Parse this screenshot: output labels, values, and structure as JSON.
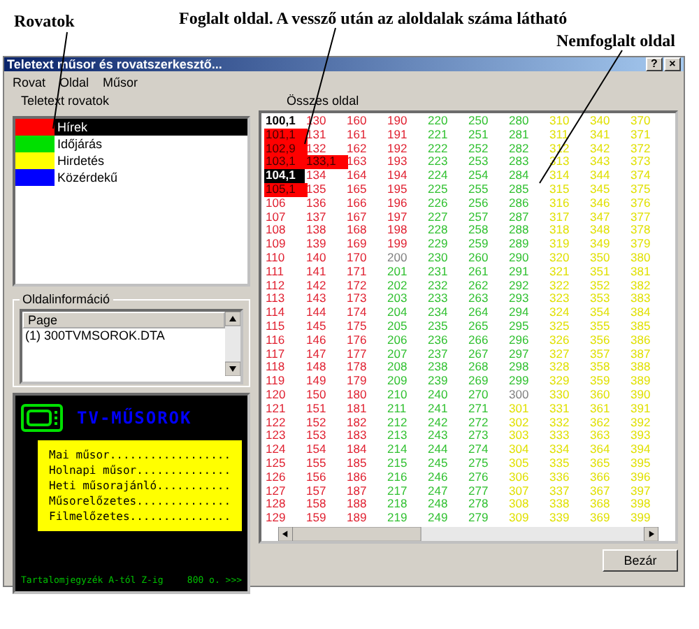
{
  "annotations": [
    {
      "text": "Rovatok"
    },
    {
      "text": "Foglalt oldal. A vessző után az aloldalak száma látható"
    },
    {
      "text": "Nemfoglalt oldal"
    }
  ],
  "window": {
    "title": "Teletext műsor és rovatszerkesztő...",
    "title_buttons": [
      "?",
      "×"
    ]
  },
  "menu": [
    "Rovat",
    "Oldal",
    "Műsor"
  ],
  "rubrics": {
    "label": "Teletext rovatok",
    "items": [
      {
        "name": "Hírek",
        "color": "#ff0000",
        "selected": true
      },
      {
        "name": "Időjárás",
        "color": "#00e000",
        "selected": false
      },
      {
        "name": "Hirdetés",
        "color": "#ffff00",
        "selected": false
      },
      {
        "name": "Közérdekű",
        "color": "#0000ff",
        "selected": false
      }
    ]
  },
  "page_info": {
    "label": "Oldalinformáció",
    "header": "Page",
    "items": [
      "(1) 300TVMSOROK.DTA"
    ]
  },
  "teletext": {
    "title": "TV-MŰSOROK",
    "lines": [
      "Mai műsor..................",
      "Holnapi műsor..............",
      "Heti műsorajánló...........",
      "Műsorelőzetes..............",
      "Filmelőzetes..............."
    ],
    "footer": "Tartalomjegyzék A-tól Z-ig",
    "footer_page": "800 o. >>>"
  },
  "grid": {
    "label": "Összes oldal",
    "columns": [
      {
        "runs": [
          {
            "kind": "current",
            "cells": [
              "100,1"
            ]
          },
          {
            "kind": "occupied",
            "cells": [
              "101,1",
              "102,9",
              "103,1"
            ]
          },
          {
            "kind": "selected",
            "cells": [
              "104,1"
            ]
          },
          {
            "kind": "occupied",
            "cells": [
              "105,1"
            ]
          },
          {
            "color": "#e02030",
            "cells": [
              "106",
              "107",
              "108",
              "109",
              "110",
              "111",
              "112",
              "113",
              "114",
              "115",
              "116",
              "117",
              "118",
              "119",
              "120",
              "121",
              "122",
              "123",
              "124",
              "125",
              "126",
              "127",
              "128",
              "129"
            ]
          }
        ]
      },
      {
        "runs": [
          {
            "color": "#e02030",
            "cells": [
              "130",
              "131",
              "132"
            ]
          },
          {
            "kind": "occupied",
            "cells": [
              "133,1"
            ]
          },
          {
            "color": "#e02030",
            "cells": [
              "134",
              "135",
              "136",
              "137",
              "138",
              "139",
              "140",
              "141",
              "142",
              "143",
              "144",
              "145",
              "146",
              "147",
              "148",
              "149",
              "150",
              "151",
              "152",
              "153",
              "154",
              "155",
              "156",
              "157",
              "158",
              "159"
            ]
          }
        ]
      },
      {
        "runs": [
          {
            "color": "#e02030",
            "cells": [
              "160",
              "161",
              "162",
              "163",
              "164",
              "165",
              "166",
              "167",
              "168",
              "169",
              "170",
              "171",
              "172",
              "173",
              "174",
              "175",
              "176",
              "177",
              "178",
              "179",
              "180",
              "181",
              "182",
              "183",
              "184",
              "185",
              "186",
              "187",
              "188",
              "189"
            ]
          }
        ]
      },
      {
        "runs": [
          {
            "color": "#e02030",
            "cells": [
              "190",
              "191",
              "192",
              "193",
              "194",
              "195",
              "196",
              "197",
              "198",
              "199"
            ]
          },
          {
            "color": "#808080",
            "cells": [
              "200"
            ]
          },
          {
            "color": "#30c030",
            "cells": [
              "201",
              "202",
              "203",
              "204",
              "205",
              "206",
              "207",
              "208",
              "209",
              "210",
              "211",
              "212",
              "213",
              "214",
              "215",
              "216",
              "217",
              "218",
              "219"
            ]
          }
        ]
      },
      {
        "runs": [
          {
            "color": "#30c030",
            "cells": [
              "220",
              "221",
              "222",
              "223",
              "224",
              "225",
              "226",
              "227",
              "228",
              "229",
              "230",
              "231",
              "232",
              "233",
              "234",
              "235",
              "236",
              "237",
              "238",
              "239",
              "240",
              "241",
              "242",
              "243",
              "244",
              "245",
              "246",
              "247",
              "248",
              "249"
            ]
          }
        ]
      },
      {
        "runs": [
          {
            "color": "#30c030",
            "cells": [
              "250",
              "251",
              "252",
              "253",
              "254",
              "255",
              "256",
              "257",
              "258",
              "259",
              "260",
              "261",
              "262",
              "263",
              "264",
              "265",
              "266",
              "267",
              "268",
              "269",
              "270",
              "271",
              "272",
              "273",
              "274",
              "275",
              "276",
              "277",
              "278",
              "279"
            ]
          }
        ]
      },
      {
        "runs": [
          {
            "color": "#30c030",
            "cells": [
              "280",
              "281",
              "282",
              "283",
              "284",
              "285",
              "286",
              "287",
              "288",
              "289",
              "290",
              "291",
              "292",
              "293",
              "294",
              "295",
              "296",
              "297",
              "298",
              "299"
            ]
          },
          {
            "color": "#808080",
            "cells": [
              "300"
            ]
          },
          {
            "color": "#e0e000",
            "cells": [
              "301",
              "302",
              "303",
              "304",
              "305",
              "306",
              "307",
              "308",
              "309"
            ]
          }
        ]
      },
      {
        "runs": [
          {
            "color": "#e0e000",
            "cells": [
              "310",
              "311",
              "312",
              "313",
              "314",
              "315",
              "316",
              "317",
              "318",
              "319",
              "320",
              "321",
              "322",
              "323",
              "324",
              "325",
              "326",
              "327",
              "328",
              "329",
              "330",
              "331",
              "332",
              "333",
              "334",
              "335",
              "336",
              "337",
              "338",
              "339"
            ]
          }
        ]
      },
      {
        "runs": [
          {
            "color": "#e0e000",
            "cells": [
              "340",
              "341",
              "342",
              "343",
              "344",
              "345",
              "346",
              "347",
              "348",
              "349",
              "350",
              "351",
              "352",
              "353",
              "354",
              "355",
              "356",
              "357",
              "358",
              "359",
              "360",
              "361",
              "362",
              "363",
              "364",
              "365",
              "366",
              "367",
              "368",
              "369"
            ]
          }
        ]
      },
      {
        "runs": [
          {
            "color": "#e0e000",
            "cells": [
              "370",
              "371",
              "372",
              "373",
              "374",
              "375",
              "376",
              "377",
              "378",
              "379",
              "380",
              "381",
              "382",
              "383",
              "384",
              "385",
              "386",
              "387",
              "388",
              "389",
              "390",
              "391",
              "392",
              "393",
              "394",
              "395",
              "396",
              "397",
              "398",
              "399"
            ]
          }
        ]
      }
    ]
  },
  "buttons": [
    "Bezár"
  ]
}
